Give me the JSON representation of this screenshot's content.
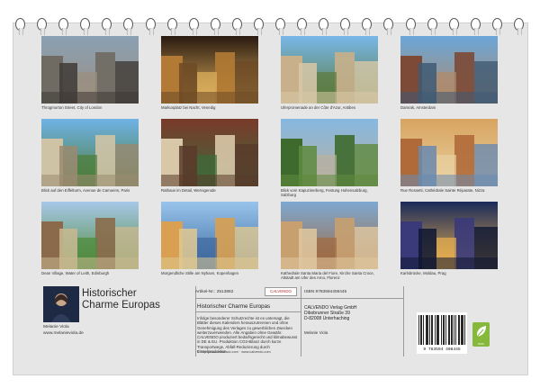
{
  "cover": {
    "title_line1": "Historischer",
    "title_line2": "Charme Europas",
    "author_name": "Melanie Viola",
    "author_website": "www.melanieviola.de"
  },
  "photos": [
    {
      "caption": "Throgmorton Street, City of London",
      "palette": [
        "#8aa0b4",
        "#6f6a62",
        "#9b8f7f",
        "#3e3a36"
      ]
    },
    {
      "caption": "Markusplatz bei Nacht, Venedig",
      "palette": [
        "#2a1a10",
        "#b27a34",
        "#e0b25e",
        "#6e4a26"
      ]
    },
    {
      "caption": "Uferpromenade an der Côte d'Azur, Antibes",
      "palette": [
        "#78b7e8",
        "#c8b08a",
        "#5c7a3c",
        "#d8c8a8"
      ]
    },
    {
      "caption": "Damrak, Amsterdam",
      "palette": [
        "#6aa6d8",
        "#7c4a36",
        "#b08a6a",
        "#3e5a74"
      ]
    },
    {
      "caption": "Blick auf den Eiffelturm, Avenue de Camoens, Paris",
      "palette": [
        "#6fb2e6",
        "#cfc3a6",
        "#4e7e3a",
        "#9a8a70"
      ]
    },
    {
      "caption": "Rathaus im Detail, Wernigerode",
      "palette": [
        "#7a3a2a",
        "#d8c8a8",
        "#3e6a3a",
        "#5a3a2a"
      ]
    },
    {
      "caption": "Blick vom Kapuzinerberg, Festung Hohensalzburg, Salzburg",
      "palette": [
        "#86b8e0",
        "#3e6a2e",
        "#b8b0a0",
        "#5e8a3e"
      ]
    },
    {
      "caption": "Rue Rossetti, Cathédrale Sainte Réparate, Nizza",
      "palette": [
        "#d8a460",
        "#b06a3a",
        "#e8d0a0",
        "#6a8ab0"
      ]
    },
    {
      "caption": "Dean Village, Water of Leith, Edinburgh",
      "palette": [
        "#a8c8e8",
        "#8a6a4a",
        "#4e8a3a",
        "#c8b890"
      ]
    },
    {
      "caption": "Morgendliche Stille am Nyhavn, Kopenhagen",
      "palette": [
        "#98c4ec",
        "#d8a050",
        "#3e6aa0",
        "#e0c890"
      ]
    },
    {
      "caption": "Kathedrale Santa Maria del Fiore, Kirche Santa Croce, Altstadt am Ufer des Arno, Florenz",
      "palette": [
        "#7ea8d0",
        "#c8a070",
        "#a06a40",
        "#e0c8a0"
      ]
    },
    {
      "caption": "Karlsbrücke, Moldau, Prag",
      "palette": [
        "#1a2a5a",
        "#3a3a7a",
        "#e8b050",
        "#0e1632"
      ]
    }
  ],
  "info": {
    "artikel": "Artikel-Nr.: 2513882",
    "isbn": "ISBN 9783594408445",
    "calendar_title": "Historischer Charme Europas",
    "logo_text": "CALVENDO",
    "desc_1": "Infolge besonderer Schutzrechte ist es untersagt, die Blätter dieses Kalenders herauszutrennen und ohne Genehmigung des Verlages zu gewerblichen Zwecken weiterzuverwenden. Alle Angaben ohne Gewähr.",
    "desc_2": "CALVENDO produziert bedarfsgerecht und klimabewusst in DE & EU. Produktion CO2-Bilanz durch kurze Transportwege, Abfall-Reduzierung durch Einzelproduktion.",
    "copyright_line": "© http://www.calvendo.com · www.calvendo.com",
    "publisher_lines": [
      "CALVENDO Verlag GmbH",
      "Dibobrunner Straße 39",
      "D-82008 Unterhaching"
    ],
    "photographer": "Melanie Viola",
    "barcode_number": "9 783594 408445",
    "eco_label": "eco"
  },
  "colors": {
    "sheet": "#e6e6e6",
    "ring": "#5a5a5a",
    "eco_green": "#86b83c"
  }
}
